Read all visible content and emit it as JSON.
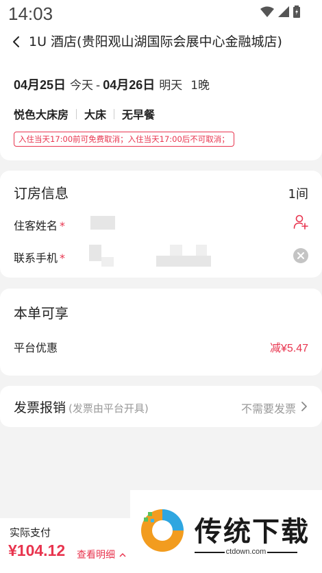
{
  "status_bar": {
    "time": "14:03"
  },
  "header": {
    "title": "1U 酒店(贵阳观山湖国际会展中心金融城店)",
    "checkin_date": "04月25日",
    "checkin_day": "今天",
    "dash": "-",
    "checkout_date": "04月26日",
    "checkout_day": "明天",
    "nights": "1晚",
    "room_name": "悦色大床房",
    "bed_type": "大床",
    "breakfast": "无早餐",
    "cancel_policy": "入住当天17:00前可免费取消；入住当天17:00后不可取消；"
  },
  "booking": {
    "title": "订房信息",
    "room_count": "1间",
    "guest_label": "住客姓名",
    "phone_label": "联系手机",
    "required_mark": "*"
  },
  "benefits": {
    "title": "本单可享",
    "platform_discount_label": "平台优惠",
    "platform_discount_value": "减¥5.47"
  },
  "invoice": {
    "title": "发票报销",
    "note": "(发票由平台开具)",
    "status": "不需要发票"
  },
  "footer": {
    "pay_label": "实际支付",
    "pay_amount": "¥104.12",
    "detail_link": "查看明细"
  },
  "watermark": {
    "text": "传统下载",
    "url": "ctdown.com"
  },
  "colors": {
    "accent": "#e8344e",
    "background": "#f3f3f3"
  }
}
